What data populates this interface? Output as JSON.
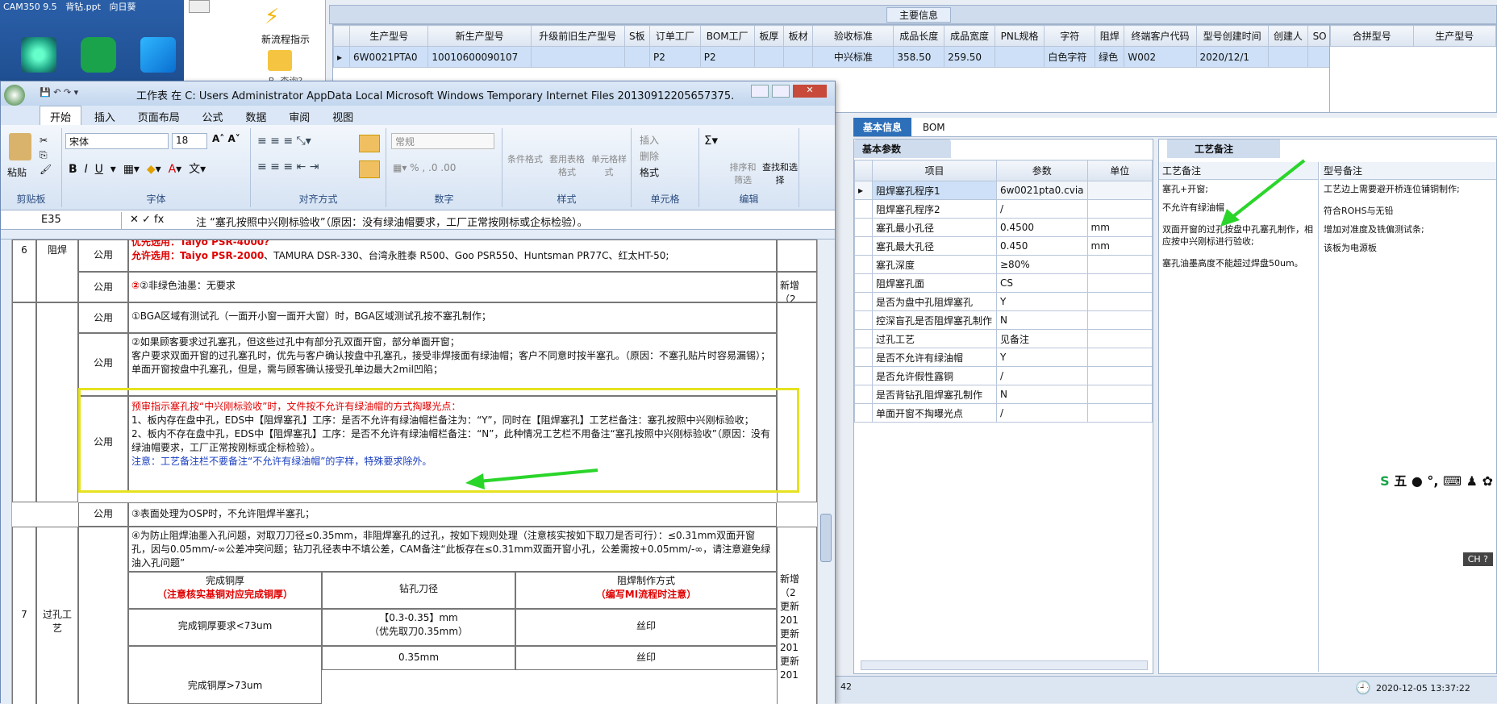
{
  "desktop": {
    "top_labels": [
      "CAM350 9.5",
      "背钻.ppt",
      "向日葵"
    ]
  },
  "flow": {
    "new_label": "新流程指示",
    "query_label": "B. 查询?"
  },
  "main_info": {
    "title": "主要信息",
    "columns": [
      "生产型号",
      "新生产型号",
      "升级前旧生产型号",
      "S板",
      "订单工厂",
      "BOM工厂",
      "板厚",
      "板材",
      "验收标准",
      "成品长度",
      "成品宽度",
      "PNL规格",
      "字符",
      "阻焊",
      "终端客户代码",
      "型号创建时间",
      "创建人",
      "SO"
    ],
    "row": [
      "6W0021PTA0",
      "10010600090107",
      "",
      "",
      "P2",
      "P2",
      "",
      "",
      "中兴标准",
      "358.50",
      "259.50",
      "",
      "白色字符",
      "绿色",
      "W002",
      "2020/12/1",
      "",
      ""
    ],
    "side_columns": [
      "合拼型号",
      "生产型号"
    ]
  },
  "tabs": {
    "selected": "基本信息",
    "other": "BOM"
  },
  "basic": {
    "tab": "基本参数",
    "columns": [
      "项目",
      "参数",
      "单位"
    ],
    "rows": [
      {
        "item": "阻焊塞孔程序1",
        "value": "6w0021pta0.cvia",
        "unit": ""
      },
      {
        "item": "阻焊塞孔程序2",
        "value": "/",
        "unit": ""
      },
      {
        "item": "塞孔最小孔径",
        "value": "0.4500",
        "unit": "mm"
      },
      {
        "item": "塞孔最大孔径",
        "value": "0.450",
        "unit": "mm"
      },
      {
        "item": "塞孔深度",
        "value": "≥80%",
        "unit": ""
      },
      {
        "item": "阻焊塞孔面",
        "value": "CS",
        "unit": ""
      },
      {
        "item": "是否为盘中孔阻焊塞孔",
        "value": "Y",
        "unit": ""
      },
      {
        "item": "控深盲孔是否阻焊塞孔制作",
        "value": "N",
        "unit": ""
      },
      {
        "item": "过孔工艺",
        "value": "见备注",
        "unit": ""
      },
      {
        "item": "是否不允许有绿油帽",
        "value": "Y",
        "unit": ""
      },
      {
        "item": "是否允许假性露铜",
        "value": "/",
        "unit": ""
      },
      {
        "item": "是否背钻孔阻焊塞孔制作",
        "value": "N",
        "unit": ""
      },
      {
        "item": "单面开窗不掏曝光点",
        "value": "/",
        "unit": ""
      }
    ]
  },
  "process": {
    "tab": "工艺备注",
    "col1": "工艺备注",
    "col2": "型号备注",
    "notes1": [
      "塞孔+开窗;",
      "不允许有绿油帽",
      "双面开窗的过孔按盘中孔塞孔制作，相应按中兴刚标进行验收;",
      "塞孔油墨高度不能超过焊盘50um。"
    ],
    "notes2": [
      "工艺边上需要避开桥连位铺铜制作;",
      "符合ROHS与无铅",
      "增加对准度及铣偏测试条;",
      "该板为电源板"
    ]
  },
  "status": {
    "left": "42",
    "datetime": "2020-12-05 13:37:22",
    "ime": "五",
    "ime2": "CH"
  },
  "excel": {
    "title": "工作表 在 C: Users Administrator AppData Local Microsoft Windows Temporary Internet Files 20130912205657375.doc - Micr...",
    "tabs": [
      "开始",
      "插入",
      "页面布局",
      "公式",
      "数据",
      "审阅",
      "视图"
    ],
    "groups": [
      "剪贴板",
      "字体",
      "对齐方式",
      "数字",
      "样式",
      "单元格",
      "编辑"
    ],
    "paste": "粘贴",
    "font": "宋体",
    "size": "18",
    "numfmt": "常规",
    "style_btns": [
      "条件格式",
      "套用表格格式",
      "单元格样式"
    ],
    "cell_btns": [
      "插入",
      "删除",
      "格式"
    ],
    "edit_btns": [
      "排序和筛选",
      "查找和选择"
    ],
    "namebox": "E35",
    "formula": "注 “塞孔按照中兴刚标验收”（原因：没有绿油帽要求，工厂正常按刚标或企标检验）。",
    "rows": [
      {
        "no": "6",
        "cat": "阻焊",
        "pub": "公用",
        "l1": "优先选用：Taiyo PSR-4000?",
        "l2a": "允许选用：",
        "l2b": "Taiyo PSR-2000",
        "l2c": "、TAMURA DSR-330、台湾永胜泰 R500、Goo PSR550、Huntsman PR77C、红太HT-50;"
      },
      {
        "pub": "公用",
        "t": "②非绿色油墨：无要求",
        "note": "新增（2"
      },
      {
        "pub": "公用",
        "t": "①BGA区域有测试孔（一面开小窗一面开大窗）时，BGA区域测试孔按不塞孔制作；"
      },
      {
        "pub": "公用",
        "l1": "②如果顾客要求过孔塞孔，但这些过孔中有部分孔双面开窗，部分单面开窗；",
        "l2": "客户要求双面开窗的过孔塞孔时，优先与客户确认按盘中孔塞孔，接受非焊接面有绿油帽；客户不同意时按半塞孔。（原因：不塞孔贴片时容易漏锡）；",
        "l3": "单面开窗按盘中孔塞孔，但是，需与顾客确认接受孔单边最大2mil凹陷；"
      },
      {
        "pub": "公用",
        "h": "预审指示塞孔按“中兴刚标验收”时，文件按不允许有绿油帽的方式掏曝光点：",
        "a": "1、板内存在盘中孔，EDS中【阻焊塞孔】工序：是否不允许有绿油帽栏备注为：“Y”，同时在【阻焊塞孔】工艺栏备注：塞孔按照中兴刚标验收；",
        "b": "2、板内不存在盘中孔，EDS中【阻焊塞孔】工序：是否不允许有绿油帽栏备注：“N”，此种情况工艺栏不用备注“塞孔按照中兴刚标验收”（原因：没有绿油帽要求，工厂正常按刚标或企标检验）。",
        "c": "注意：工艺备注栏不要备注“不允许有绿油帽”的字样，特殊要求除外。"
      },
      {
        "pub": "公用",
        "t": "③表面处理为OSP时，不允许阻焊半塞孔；"
      },
      {
        "no": "7",
        "cat": "过孔工艺",
        "pub": "公用",
        "p1": "④为防止阻焊油墨入孔问题，对取刀刀径≤0.35mm，非阻焊塞孔的过孔，按如下规则处理（注意核实按如下取刀是否可行）：≤0.31mm双面开窗孔，因与0.05mm/-∞公差冲突问题；钻刀孔径表中不填公差，CAM备注“此板存在≤0.31mm双面开窗小孔，公差需按+0.05mm/-∞，请注意避免绿油入孔问题”",
        "th": [
          "完成铜厚",
          "钻孔刀径",
          "阻焊制作方式"
        ],
        "th_sub": [
          "（注意核实基铜对应完成铜厚）",
          "",
          "（编写MI流程时注意）"
        ],
        "r1": [
          "完成铜厚要求<73um",
          "【0.3-0.35】mm\n（优先取刀0.35mm）",
          "丝印"
        ],
        "r2": [
          "完成铜厚>73um",
          "0.35mm",
          "丝印"
        ],
        "notes": [
          "新增（2",
          "更新201",
          "更新201",
          "更新201"
        ]
      }
    ]
  }
}
